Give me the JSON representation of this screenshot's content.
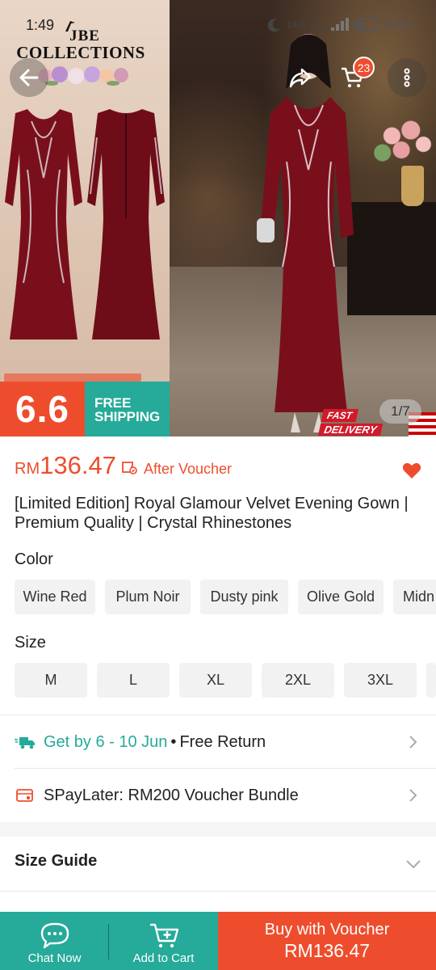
{
  "status_bar": {
    "time": "1:49",
    "network": "14.0",
    "net_label": "Vo LTE",
    "battery": "41%"
  },
  "hero": {
    "logo_line1": "JBE",
    "logo_line2": "COLLECTIONS",
    "cart_count": "23",
    "banner_66": "6.6",
    "banner_free": "FREE",
    "banner_shipping": "SHIPPING",
    "fast_line1": "FAST",
    "fast_line2": "DELIVERY",
    "image_counter": "1/7"
  },
  "product": {
    "currency": "RM",
    "price": "136.47",
    "after_voucher": "After Voucher",
    "title": "[Limited Edition] Royal Glamour Velvet Evening Gown | Premium Quality | Crystal Rhinestones"
  },
  "color_section": {
    "label": "Color",
    "options": [
      "Wine Red",
      "Plum Noir",
      "Dusty pink",
      "Olive Gold",
      "Midn"
    ]
  },
  "size_section": {
    "label": "Size",
    "options": [
      "M",
      "L",
      "XL",
      "2XL",
      "3XL"
    ]
  },
  "delivery": {
    "get_by": "Get by 6 - 10 Jun",
    "separator": "•",
    "free_return": "Free Return"
  },
  "spaylater": {
    "text": "SPayLater: RM200 Voucher Bundle"
  },
  "size_guide": {
    "label": "Size Guide"
  },
  "bottom_bar": {
    "chat": "Chat Now",
    "add_to_cart": "Add to Cart",
    "buy_line1": "Buy with Voucher",
    "buy_line2": "RM136.47"
  },
  "colors": {
    "primary": "#ee4d2d",
    "teal": "#26aa99",
    "gown": "#7a0f1c"
  }
}
